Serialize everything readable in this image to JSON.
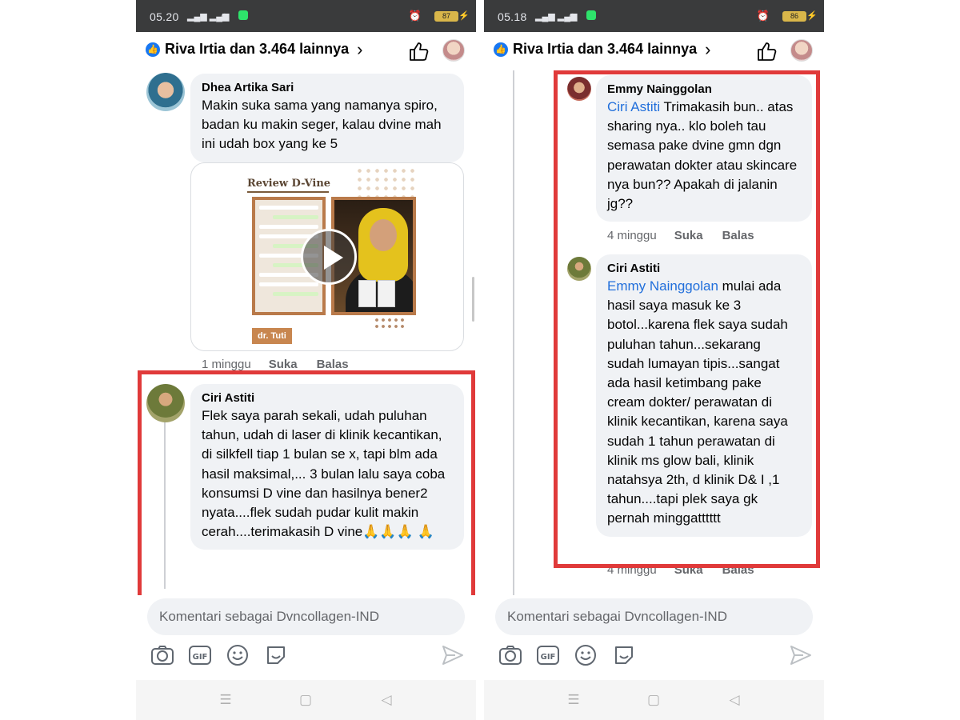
{
  "left": {
    "status": {
      "time": "05.20",
      "battery": "87"
    },
    "header": {
      "likes_text": "Riva Irtia dan 3.464 lainnya"
    },
    "comments": [
      {
        "name": "Dhea Artika Sari",
        "text": "Makin suka sama yang namanya spiro, badan ku makin seger, kalau dvine mah ini udah box yang ke 5",
        "media": {
          "title": "Review D-Vine",
          "tag": "dr. Tuti"
        },
        "time": "1 minggu",
        "like": "Suka",
        "reply": "Balas"
      },
      {
        "name": "Ciri Astiti",
        "text": "Flek saya parah sekali, udah puluhan tahun, udah di laser di klinik kecantikan, di silkfell tiap 1 bulan se x, tapi blm ada hasil maksimal,... 3 bulan lalu saya coba konsumsi D vine dan hasilnya bener2 nyata....flek sudah pudar kulit makin cerah....terimakasih D vine🙏🙏🙏 🙏"
      }
    ],
    "composer": {
      "placeholder": "Komentari sebagai Dvncollagen-IND"
    }
  },
  "right": {
    "status": {
      "time": "05.18",
      "battery": "86"
    },
    "header": {
      "likes_text": "Riva Irtia dan 3.464 lainnya"
    },
    "comments": [
      {
        "name": "Emmy Nainggolan",
        "mention": "Ciri Astiti",
        "text": " Trimakasih bun.. atas sharing nya.. klo boleh tau semasa pake dvine gmn dgn perawatan dokter atau skincare nya bun?? Apakah di jalanin jg??",
        "time": "4 minggu",
        "like": "Suka",
        "reply": "Balas"
      },
      {
        "name": "Ciri Astiti",
        "mention": "Emmy Nainggolan",
        "text": " mulai ada hasil saya masuk ke 3 botol...karena flek saya sudah puluhan tahun...sekarang sudah lumayan tipis...sangat ada hasil ketimbang pake cream dokter/ perawatan di klinik kecantikan, karena saya sudah 1 tahun perawatan di klinik ms glow bali, klinik natahsya 2th, d klinik D& I ,1 tahun....tapi plek saya gk pernah minggatttttt",
        "time": "4 minggu",
        "like": "Suka",
        "reply": "Balas"
      }
    ],
    "composer": {
      "placeholder": "Komentari sebagai Dvncollagen-IND"
    }
  },
  "colors": {
    "highlight": "#e03a3a",
    "link": "#216fdb",
    "bubble": "#f0f2f5",
    "like_badge": "#1877f2"
  },
  "icons": [
    "like-badge-icon",
    "chevron-right-icon",
    "thumbs-up-icon",
    "camera-icon",
    "gif-icon",
    "emoji-icon",
    "sticker-icon",
    "send-icon",
    "play-icon",
    "menu-icon",
    "home-square-icon",
    "back-triangle-icon"
  ]
}
